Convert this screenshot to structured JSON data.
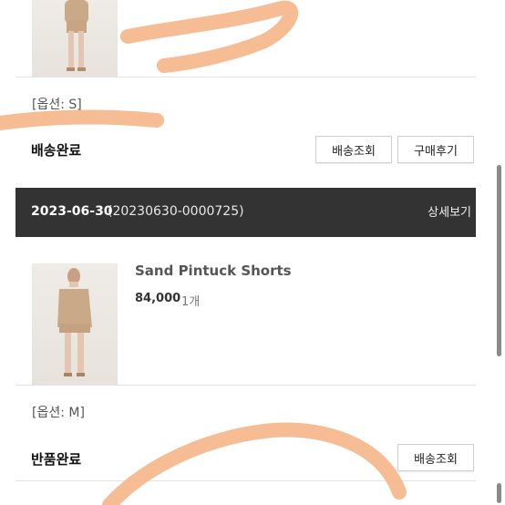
{
  "order1": {
    "option": "[옵션: S]",
    "status": "배송완료",
    "buttons": {
      "tracking": "배송조회",
      "review": "구매후기"
    }
  },
  "order2": {
    "date": "2023-06-30",
    "order_no": "(20230630-0000725)",
    "detail_link": "상세보기",
    "product": {
      "name": "Sand Pintuck Shorts",
      "price": "84,000",
      "qty": "1개"
    },
    "option": "[옵션: M]",
    "status": "반품완료",
    "buttons": {
      "tracking": "배송조회"
    }
  },
  "colors": {
    "header_bg": "#333333",
    "highlight_stroke": "#f5b68a"
  }
}
